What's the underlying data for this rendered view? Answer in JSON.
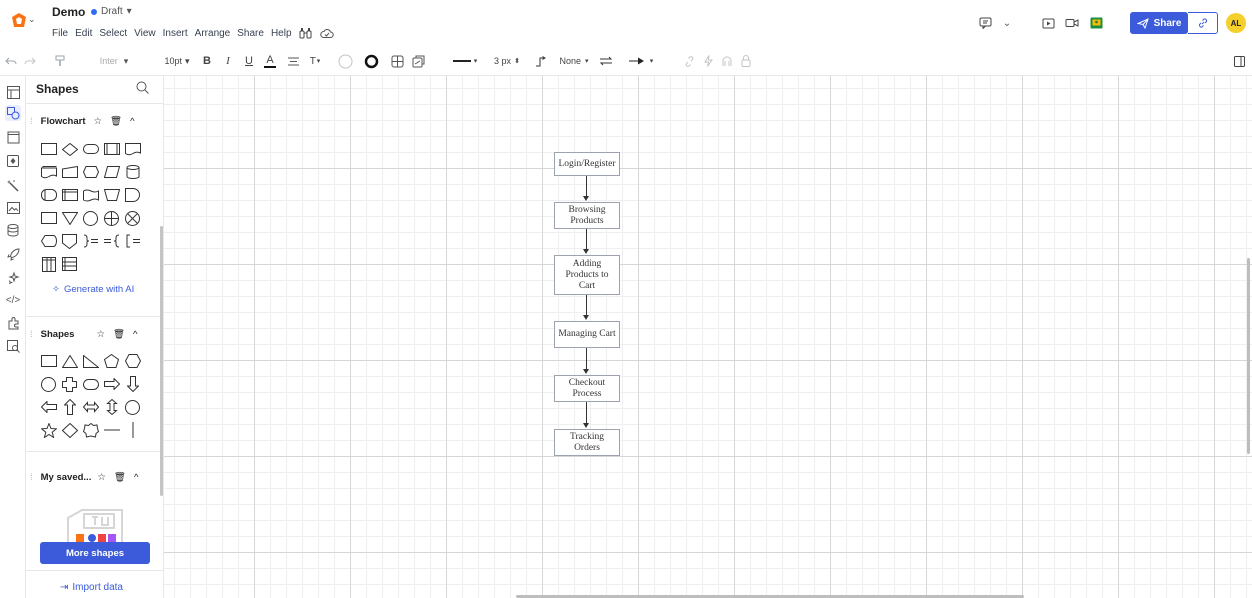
{
  "header": {
    "doc_name": "Demo",
    "status": "Draft",
    "menu": [
      "File",
      "Edit",
      "Select",
      "View",
      "Insert",
      "Arrange",
      "Share",
      "Help"
    ],
    "share_label": "Share",
    "avatar_initials": "AL",
    "accent_color": "#3b5bdb"
  },
  "toolbar": {
    "font_name": "Inter",
    "font_size": "10pt",
    "bold": "B",
    "italic": "I",
    "underline": "U",
    "text_color": "A",
    "text_case": "T",
    "line_width": "3 px",
    "line_start": "None"
  },
  "panel": {
    "title": "Shapes",
    "flowchart_title": "Flowchart",
    "generate_ai": "Generate with AI",
    "shapes_title": "Shapes",
    "saved_title": "My saved...",
    "more_shapes": "More shapes",
    "import_data": "Import data"
  },
  "diagram": {
    "nodes": [
      {
        "label": "Login/Register"
      },
      {
        "label": "Browsing Products"
      },
      {
        "label": "Adding Products to Cart"
      },
      {
        "label": "Managing Cart"
      },
      {
        "label": "Checkout Process"
      },
      {
        "label": "Tracking Orders"
      }
    ]
  }
}
